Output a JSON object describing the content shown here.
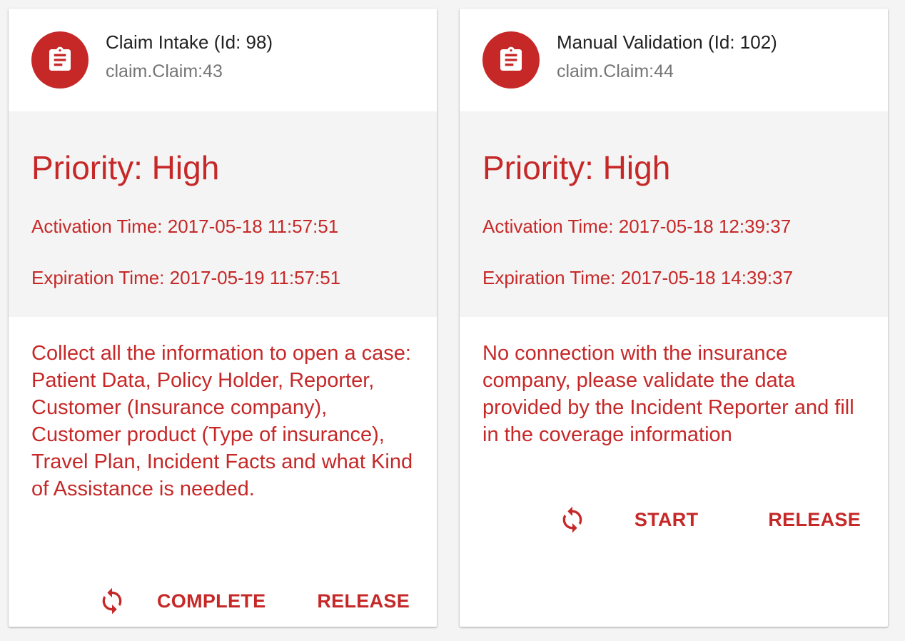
{
  "colors": {
    "accent": "#c62828",
    "title": "#212121",
    "subtitle": "#757575",
    "media_bg": "#f4f4f4",
    "card_bg": "#ffffff"
  },
  "cards": [
    {
      "avatar_icon": "clipboard-icon",
      "title": "Claim Intake (Id: 98)",
      "subtitle": "claim.Claim:43",
      "priority": "Priority: High",
      "activation": "Activation Time: 2017-05-18 11:57:51",
      "expiration": "Expiration Time: 2017-05-19 11:57:51",
      "description": "Collect all the information to open a case: Patient Data, Policy Holder, Reporter, Customer (Insurance company), Customer product (Type of insurance), Travel Plan, Incident Facts and what Kind of Assistance is needed.",
      "actions": {
        "icon": "refresh-icon",
        "primary": "COMPLETE",
        "secondary": "RELEASE"
      }
    },
    {
      "avatar_icon": "clipboard-icon",
      "title": "Manual Validation (Id: 102)",
      "subtitle": "claim.Claim:44",
      "priority": "Priority: High",
      "activation": "Activation Time: 2017-05-18 12:39:37",
      "expiration": "Expiration Time: 2017-05-18 14:39:37",
      "description": "No connection with the insurance company, please validate the data provided by the Incident Reporter and fill in the coverage information",
      "actions": {
        "icon": "refresh-icon",
        "primary": "START",
        "secondary": "RELEASE"
      }
    }
  ]
}
